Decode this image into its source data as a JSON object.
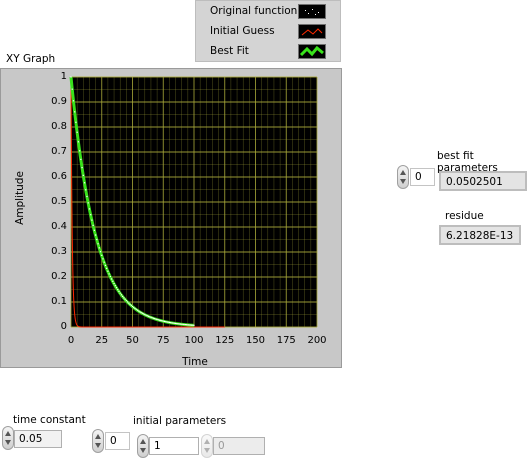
{
  "legend": {
    "items": [
      {
        "label": "Original function",
        "style": "points"
      },
      {
        "label": "Initial Guess",
        "style": "red-line"
      },
      {
        "label": "Best Fit",
        "style": "green-thick"
      }
    ]
  },
  "graph": {
    "title": "XY Graph",
    "xlabel": "Time",
    "ylabel": "Amplitude",
    "x_ticks": [
      "0",
      "25",
      "50",
      "75",
      "100",
      "125",
      "150",
      "175",
      "200"
    ],
    "y_ticks": [
      "1",
      "0.9",
      "0.8",
      "0.7",
      "0.6",
      "0.5",
      "0.4",
      "0.3",
      "0.2",
      "0.1",
      "0"
    ],
    "colors": {
      "plot_bg": "#000000",
      "grid": "#a8a83a",
      "initial": "#ff2a00",
      "fit": "#39e21b",
      "points": "#ffffff"
    }
  },
  "chart_data": {
    "type": "line",
    "xlabel": "Time",
    "ylabel": "Amplitude",
    "xlim": [
      0,
      200
    ],
    "ylim": [
      0,
      1
    ],
    "grid": true,
    "legend_position": "top",
    "series": [
      {
        "name": "Original function",
        "model": "exp(-0.05 t)",
        "x": [
          0,
          5,
          10,
          15,
          20,
          25,
          30,
          40,
          50,
          60,
          75,
          90,
          100
        ],
        "y": [
          1,
          0.779,
          0.607,
          0.472,
          0.368,
          0.287,
          0.223,
          0.135,
          0.082,
          0.05,
          0.024,
          0.011,
          0.007
        ]
      },
      {
        "name": "Initial Guess",
        "model": "exp(-1 t)",
        "x": [
          0,
          1,
          2,
          3,
          5,
          10,
          125
        ],
        "y": [
          1,
          0.368,
          0.135,
          0.05,
          0.007,
          0,
          0
        ]
      },
      {
        "name": "Best Fit",
        "model": "exp(-0.0502501 t)",
        "x": [
          0,
          5,
          10,
          15,
          20,
          25,
          30,
          40,
          50,
          60,
          75,
          90,
          100
        ],
        "y": [
          1,
          0.778,
          0.605,
          0.471,
          0.366,
          0.285,
          0.221,
          0.134,
          0.081,
          0.049,
          0.023,
          0.011,
          0.007
        ]
      }
    ]
  },
  "best_fit": {
    "label": "best fit parameters",
    "index": "0",
    "value": "0.0502501"
  },
  "residue": {
    "label": "residue",
    "value": "6.21828E-13"
  },
  "time_constant": {
    "label": "time constant",
    "value": "0.05"
  },
  "initial_parameters": {
    "label": "initial parameters",
    "index": "0",
    "values": [
      "1",
      "0"
    ]
  }
}
